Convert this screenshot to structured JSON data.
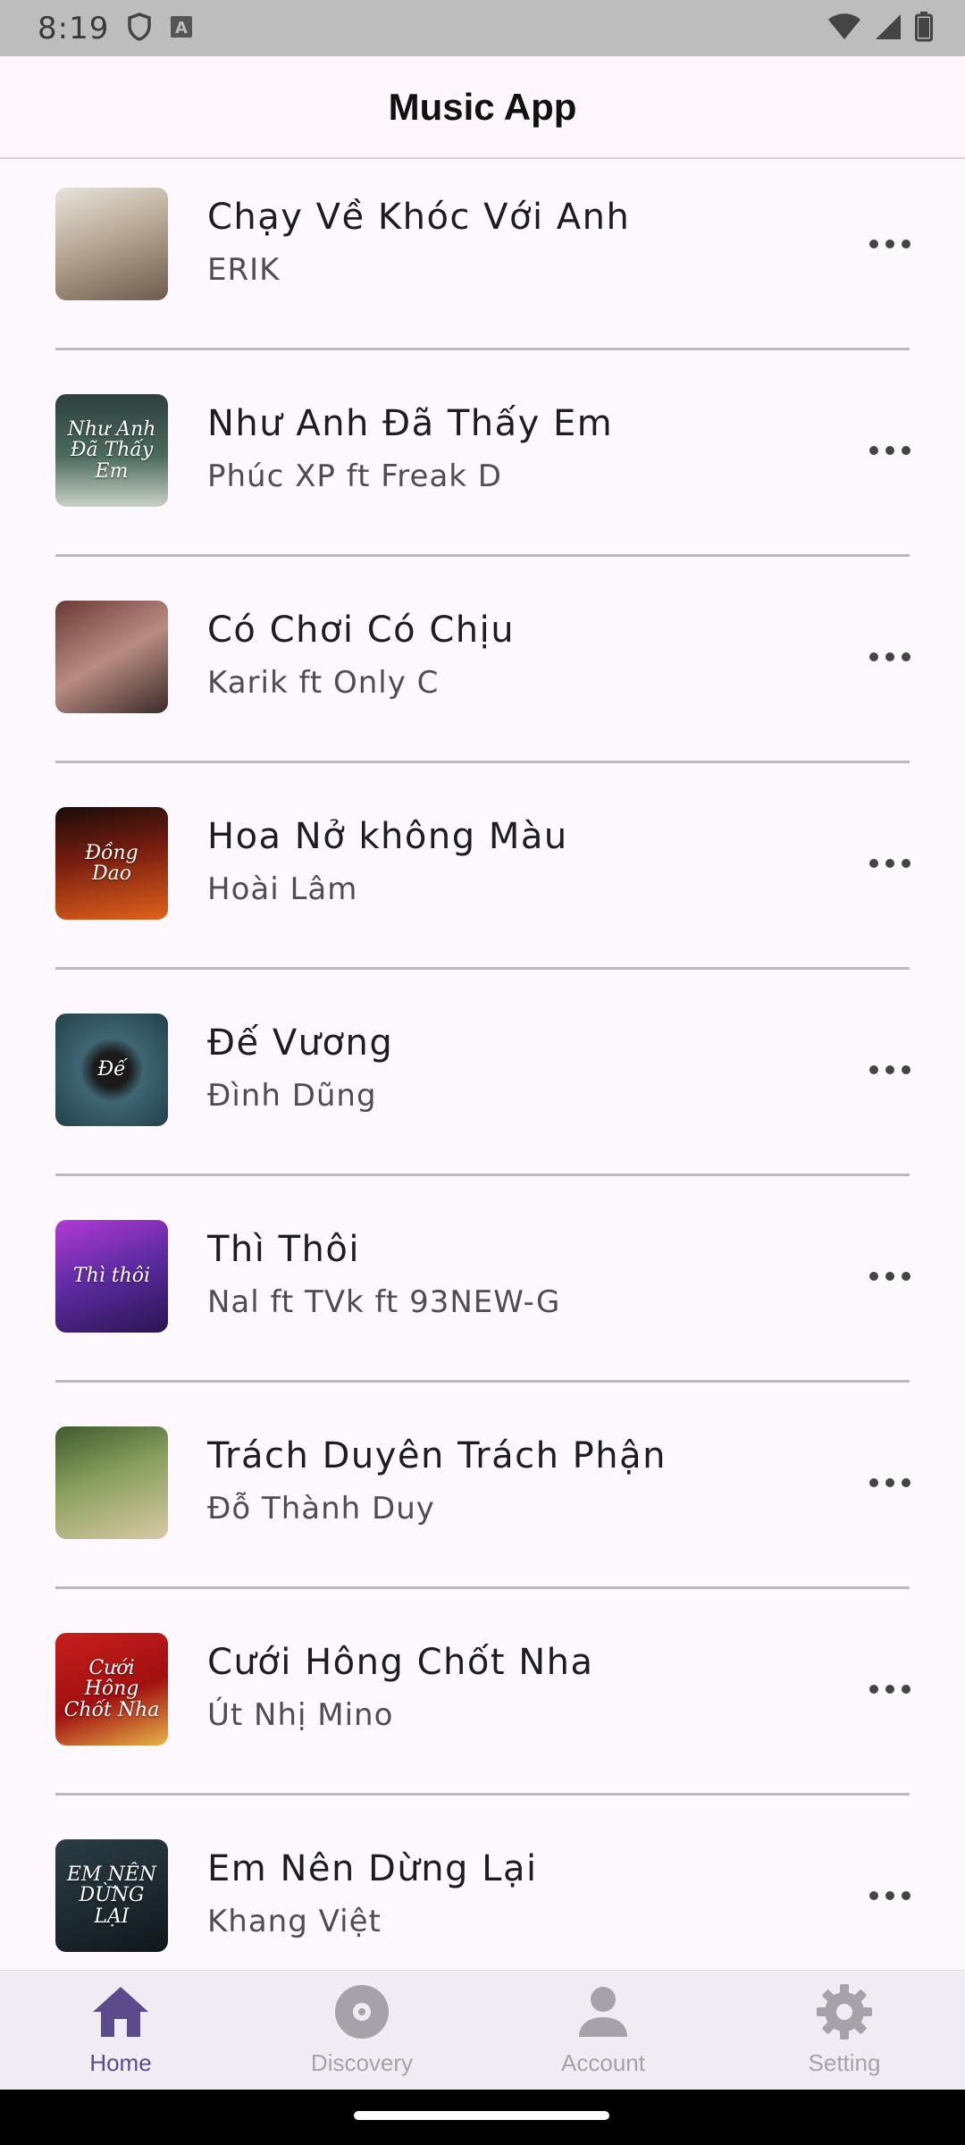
{
  "status_bar": {
    "time": "8:19",
    "icons": [
      "shield-icon",
      "keyboard-a-icon",
      "wifi-icon",
      "signal-icon",
      "battery-icon"
    ]
  },
  "app_bar": {
    "title": "Music App"
  },
  "songs": [
    {
      "title": "Chạy Về Khóc Với Anh",
      "artist": "ERIK",
      "cover_text": ""
    },
    {
      "title": "Như Anh Đã Thấy Em",
      "artist": "Phúc XP ft Freak D",
      "cover_text": "Như Anh Đã Thấy Em"
    },
    {
      "title": "Có Chơi Có Chịu",
      "artist": "Karik ft Only C",
      "cover_text": ""
    },
    {
      "title": "Hoa Nở không Màu",
      "artist": "Hoài Lâm",
      "cover_text": "Đồng Dao"
    },
    {
      "title": "Đế Vương",
      "artist": "Đình Dũng",
      "cover_text": "Đế"
    },
    {
      "title": "Thì Thôi",
      "artist": "Nal ft TVk ft 93NEW-G",
      "cover_text": "Thì thôi"
    },
    {
      "title": "Trách Duyên Trách Phận",
      "artist": "Đỗ Thành Duy",
      "cover_text": ""
    },
    {
      "title": "Cưới Hông Chốt Nha",
      "artist": "Út Nhị Mino",
      "cover_text": "Cưới Hông Chốt Nha"
    },
    {
      "title": "Em Nên Dừng Lại",
      "artist": "Khang Việt",
      "cover_text": "EM NÊN DỪNG LẠI"
    }
  ],
  "bottom_nav": {
    "items": [
      {
        "label": "Home",
        "icon": "home-icon",
        "active": true
      },
      {
        "label": "Discovery",
        "icon": "disc-icon",
        "active": false
      },
      {
        "label": "Account",
        "icon": "person-icon",
        "active": false
      },
      {
        "label": "Setting",
        "icon": "gear-icon",
        "active": false
      }
    ]
  },
  "colors": {
    "active": "#5c4b8a",
    "inactive": "#a7a1aa",
    "background": "#fdf7fe",
    "status_bar": "#bdbdbd"
  }
}
